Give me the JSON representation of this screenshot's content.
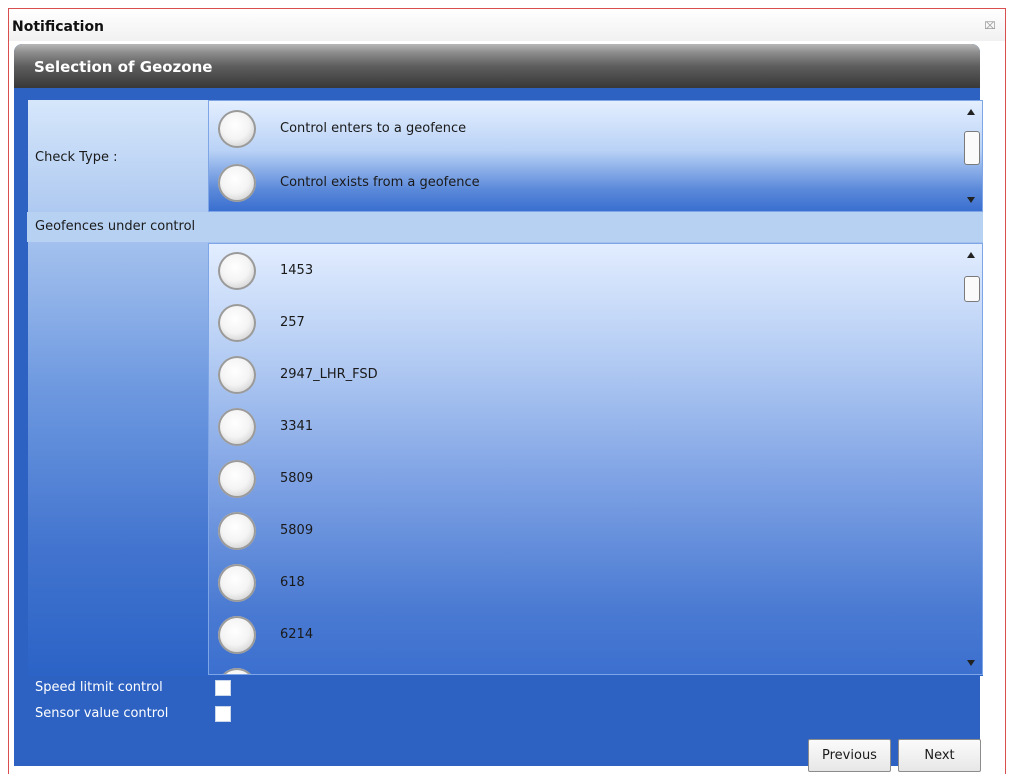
{
  "window": {
    "title": "Notification",
    "close_symbol": "⌧"
  },
  "panel": {
    "header": "Selection of Geozone"
  },
  "check_type": {
    "label": "Check Type :",
    "options": [
      "Control enters to a geofence",
      "Control exists from a geofence"
    ]
  },
  "geofences": {
    "label": "Geofences under control",
    "items": [
      "1453",
      "257",
      "2947_LHR_FSD",
      "3341",
      "5809",
      "5809",
      "618",
      "6214"
    ]
  },
  "options": {
    "speed_label": "Speed litmit control",
    "sensor_label": "Sensor value control",
    "speed_checked": false,
    "sensor_checked": false
  },
  "footer": {
    "previous_label": "Previous",
    "next_label": "Next"
  },
  "icons": {
    "close": "close-icon",
    "radio": "radio-icon",
    "scroll_up": "scroll-up-arrow-icon",
    "scroll_down": "scroll-down-arrow-icon"
  }
}
